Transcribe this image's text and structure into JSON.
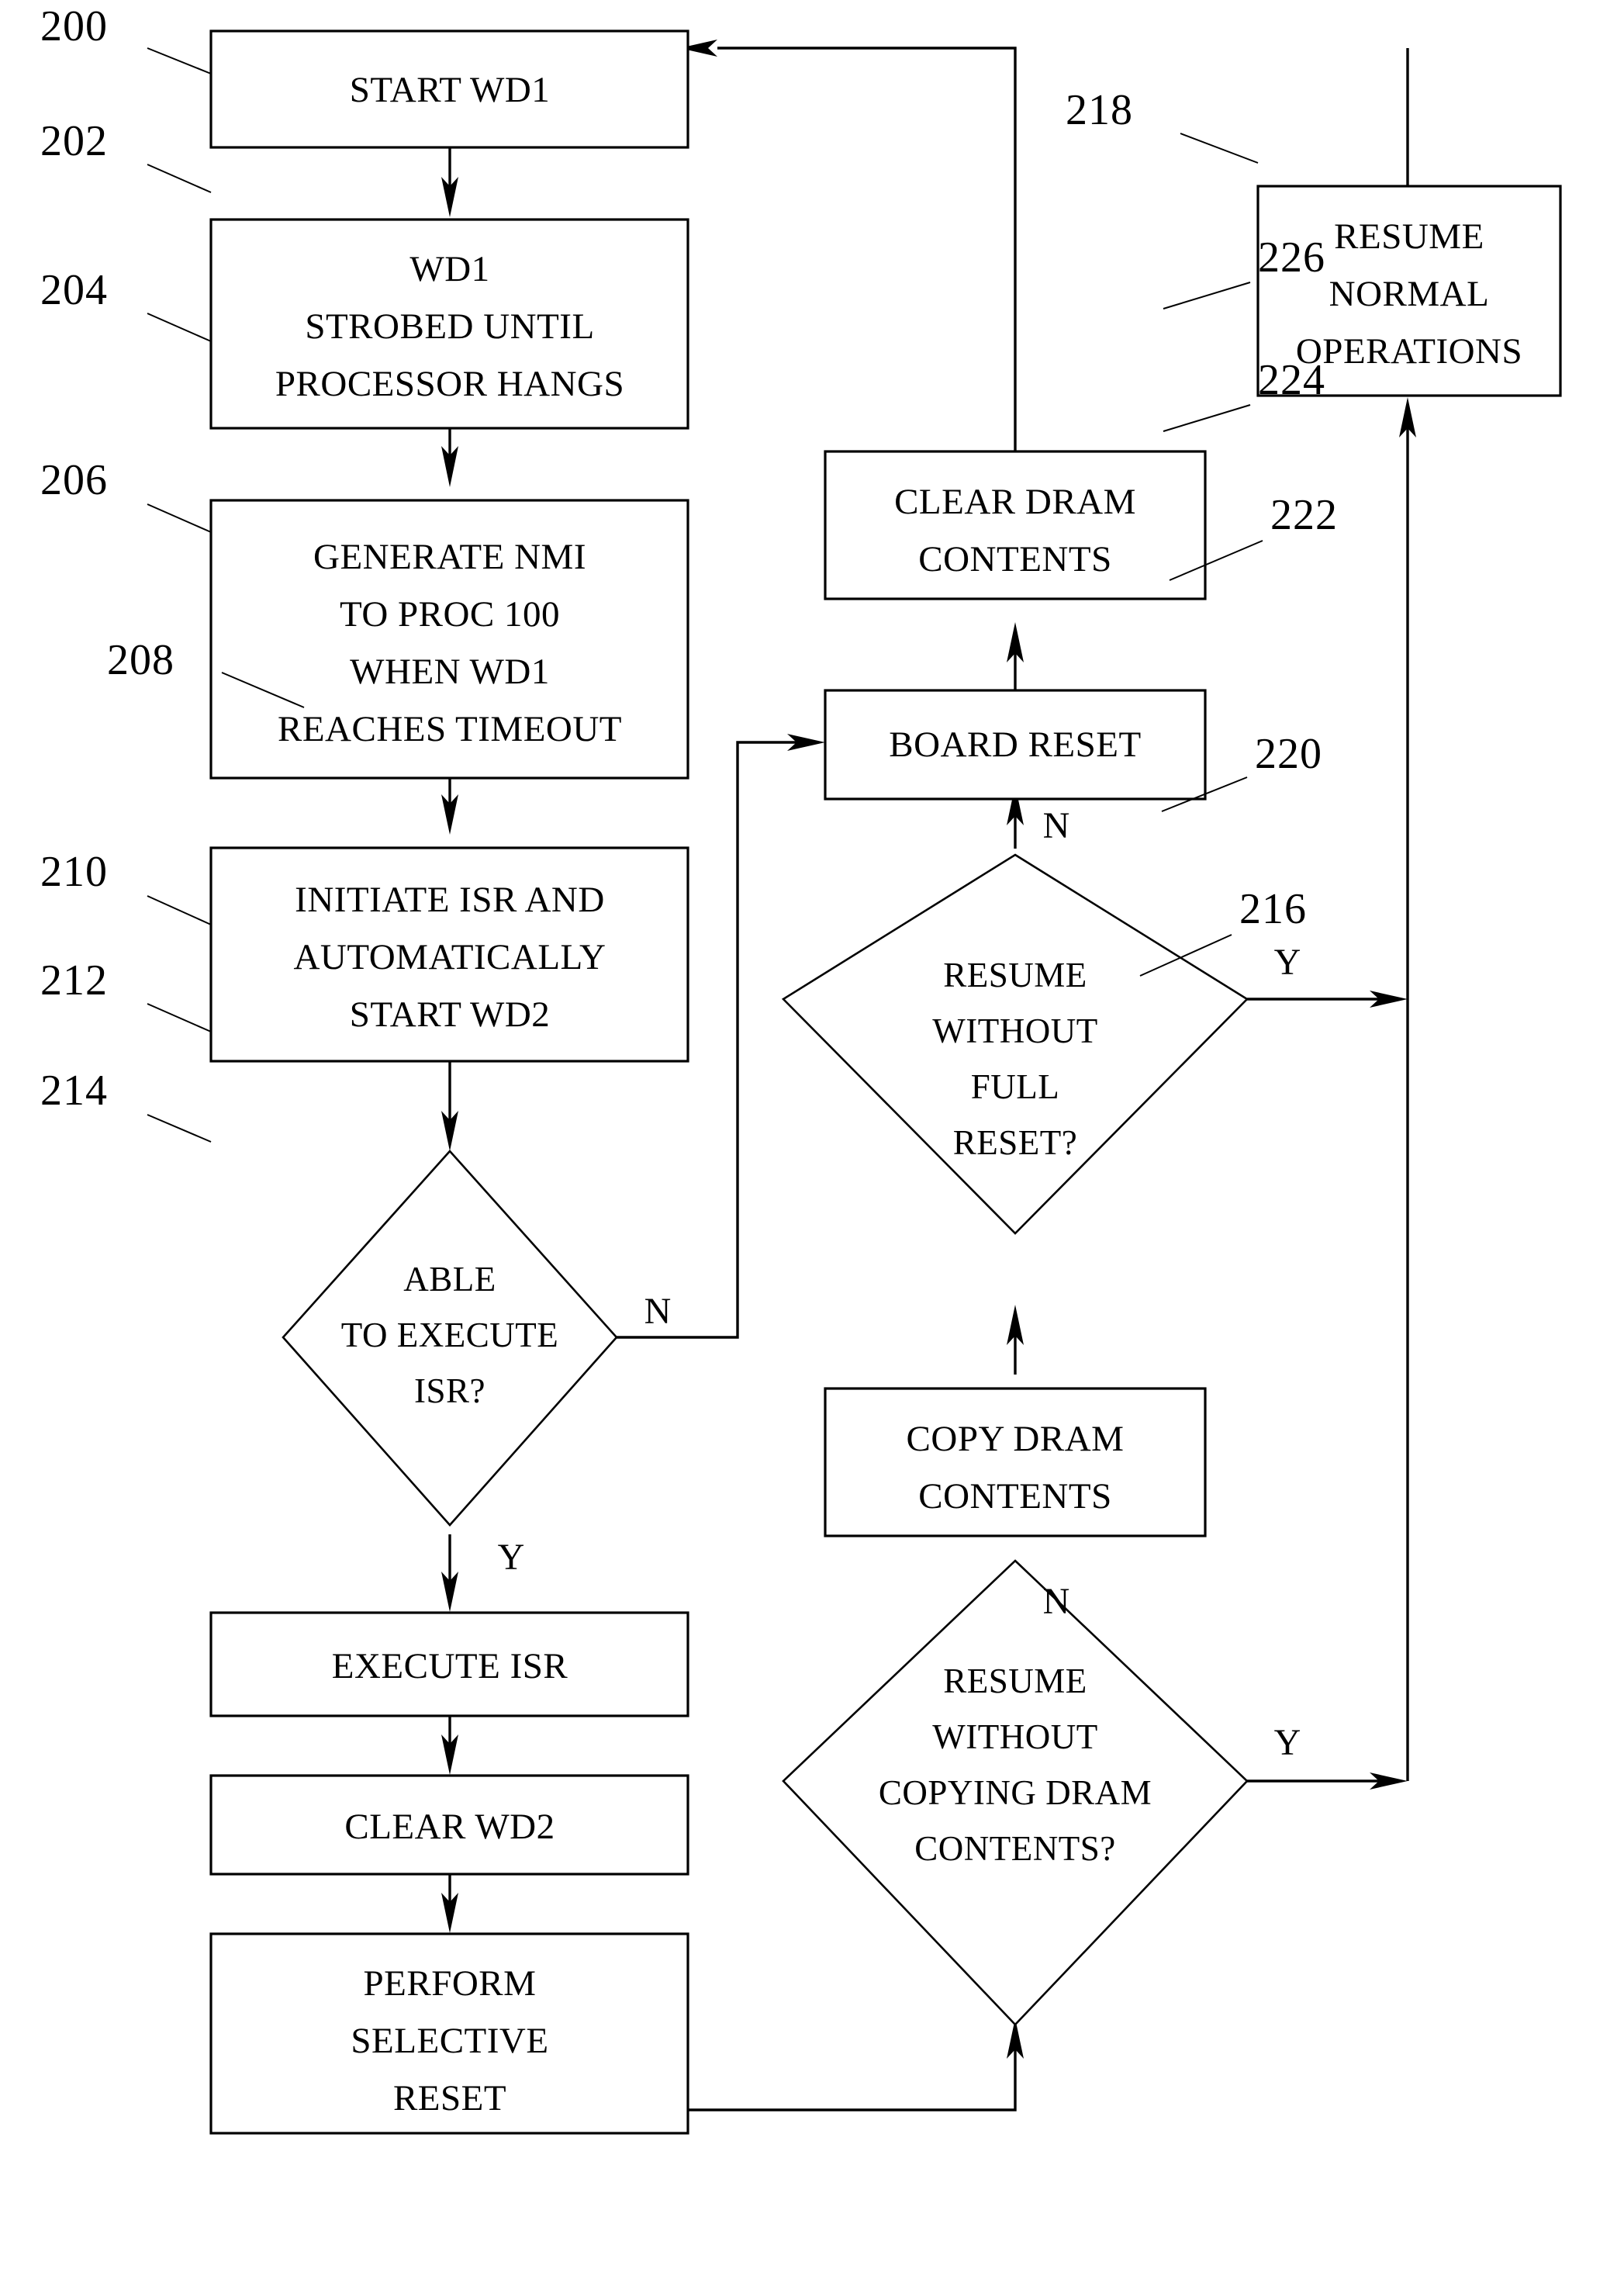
{
  "figure": {
    "type": "flowchart",
    "description": "Watchdog timer recovery process flowchart"
  },
  "nodes": {
    "n200": {
      "ref": "200",
      "shape": "process",
      "lines": [
        "START WD1"
      ]
    },
    "n202": {
      "ref": "202",
      "shape": "process",
      "lines": [
        "WD1",
        "STROBED UNTIL",
        "PROCESSOR HANGS"
      ]
    },
    "n204": {
      "ref": "204",
      "shape": "process",
      "lines": [
        "GENERATE NMI",
        "TO PROC 100",
        "WHEN WD1",
        "REACHES TIMEOUT"
      ]
    },
    "n206": {
      "ref": "206",
      "shape": "process",
      "lines": [
        "INITIATE ISR AND",
        "AUTOMATICALLY",
        "START WD2"
      ]
    },
    "n208": {
      "ref": "208",
      "shape": "decision",
      "lines": [
        "ABLE",
        "TO EXECUTE",
        "ISR?"
      ]
    },
    "n210": {
      "ref": "210",
      "shape": "process",
      "lines": [
        "EXECUTE ISR"
      ]
    },
    "n212": {
      "ref": "212",
      "shape": "process",
      "lines": [
        "CLEAR WD2"
      ]
    },
    "n214": {
      "ref": "214",
      "shape": "process",
      "lines": [
        "PERFORM",
        "SELECTIVE",
        "RESET"
      ]
    },
    "n216": {
      "ref": "216",
      "shape": "decision",
      "lines": [
        "RESUME",
        "WITHOUT",
        "COPYING DRAM",
        "CONTENTS?"
      ]
    },
    "n218": {
      "ref": "218",
      "shape": "process",
      "lines": [
        "RESUME",
        "NORMAL",
        "OPERATIONS"
      ]
    },
    "n220": {
      "ref": "220",
      "shape": "process",
      "lines": [
        "COPY DRAM",
        "CONTENTS"
      ]
    },
    "n222": {
      "ref": "222",
      "shape": "decision",
      "lines": [
        "RESUME",
        "WITHOUT",
        "FULL",
        "RESET?"
      ]
    },
    "n224": {
      "ref": "224",
      "shape": "process",
      "lines": [
        "BOARD RESET"
      ]
    },
    "n226": {
      "ref": "226",
      "shape": "process",
      "lines": [
        "CLEAR DRAM",
        "CONTENTS"
      ]
    }
  },
  "branch_labels": {
    "n208_no": "N",
    "n208_yes": "Y",
    "n216_no": "N",
    "n216_yes": "Y",
    "n222_no": "N",
    "n222_yes": "Y"
  },
  "colors": {
    "stroke": "#000000",
    "fill": "#ffffff"
  }
}
